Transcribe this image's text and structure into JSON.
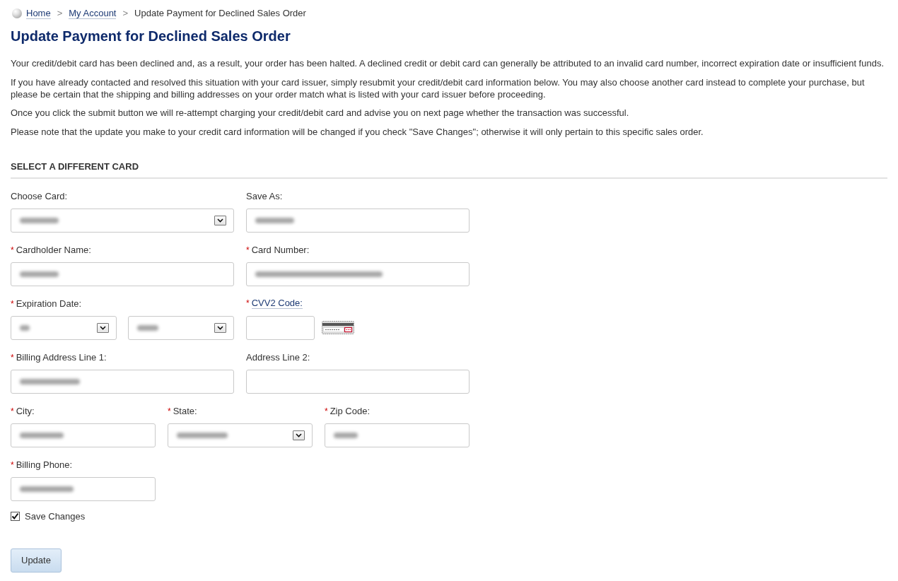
{
  "breadcrumb": [
    {
      "kind": "link",
      "label": "Home"
    },
    {
      "kind": "separator",
      "label": ">"
    },
    {
      "kind": "link",
      "label": "My Account"
    },
    {
      "kind": "separator",
      "label": ">"
    },
    {
      "kind": "current",
      "label": "Update Payment for Declined Sales Order"
    }
  ],
  "title": "Update Payment for Declined Sales Order",
  "paragraphs": [
    "Your credit/debit card has been declined and, as a result, your order has been halted. A declined credit or debit card can generally be attributed to an invalid card number, incorrect expiration date or insufficient funds.",
    "If you have already contacted and resolved this situation with your card issuer, simply resubmit your credit/debit card information below. You may also choose another card instead to complete your purchase, but please be certain that the shipping and billing addresses on your order match what is listed with your card issuer before proceeding.",
    "Once you click the submit button we will re-attempt charging your credit/debit card and advise you on next page whether the transaction was successful.",
    "Please note that the update you make to your credit card information will be changed if you check \"Save Changes\"; otherwise it will only pertain to this specific sales order."
  ],
  "form": {
    "heading": "SELECT A DIFFERENT CARD",
    "rows": [
      [
        {
          "label": "Choose Card:",
          "label_link": false,
          "controls": [
            {
              "kind": "select",
              "redacted": true
            }
          ]
        },
        {
          "label": "Save As:",
          "label_link": false,
          "controls": [
            {
              "kind": "text",
              "redacted": true
            }
          ]
        }
      ],
      [
        {
          "marker": "*",
          "label": "Cardholder Name:",
          "label_link": false,
          "controls": [
            {
              "kind": "text",
              "redacted": true
            }
          ]
        },
        {
          "marker": "*",
          "label": "Card Number:",
          "label_link": false,
          "controls": [
            {
              "kind": "text",
              "redacted": true
            }
          ]
        }
      ],
      [
        {
          "marker": "*",
          "label": "Expiration Date:",
          "label_link": false,
          "controls": [
            {
              "kind": "select",
              "redacted": true
            },
            {
              "kind": "select",
              "redacted": true
            }
          ]
        },
        {
          "marker": "*",
          "label": "CVV2 Code:",
          "label_link": true,
          "controls": [
            {
              "kind": "text",
              "redacted": false
            },
            {
              "kind": "card-hint"
            }
          ]
        }
      ],
      [
        {
          "marker": "*",
          "label": "Billing Address Line 1:",
          "label_link": false,
          "controls": [
            {
              "kind": "text",
              "redacted": true
            }
          ]
        },
        {
          "label": "Address Line 2:",
          "label_link": false,
          "controls": [
            {
              "kind": "text",
              "redacted": false
            }
          ]
        }
      ],
      [
        {
          "marker": "*",
          "label": "City:",
          "label_link": false,
          "controls": [
            {
              "kind": "text",
              "redacted": true
            }
          ]
        },
        {
          "marker": "*",
          "label": "State:",
          "label_link": false,
          "controls": [
            {
              "kind": "select",
              "redacted": true
            }
          ]
        },
        {
          "marker": "*",
          "label": "Zip Code:",
          "label_link": false,
          "controls": [
            {
              "kind": "text",
              "redacted": true
            }
          ]
        }
      ],
      [
        {
          "marker": "*",
          "label": "Billing Phone:",
          "label_link": false,
          "controls": [
            {
              "kind": "text",
              "redacted": true
            }
          ]
        }
      ]
    ]
  },
  "save_changes": {
    "label": "Save Changes",
    "checked": true
  },
  "submit_button": {
    "label": "Update"
  }
}
